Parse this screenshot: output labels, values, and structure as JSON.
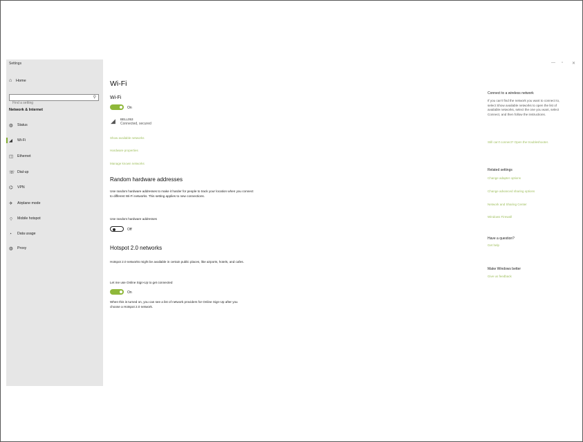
{
  "app": {
    "title": "Settings"
  },
  "window_controls": {
    "minimize": "—",
    "maximize": "▫",
    "close": "✕"
  },
  "sidebar": {
    "home_label": "Home",
    "search_placeholder": "Find a setting",
    "search_icon": "search-icon",
    "section_heading": "Network & Internet",
    "items": [
      {
        "label": "Status",
        "icon": "globe-icon"
      },
      {
        "label": "Wi-Fi",
        "icon": "wifi-icon",
        "active": true
      },
      {
        "label": "Ethernet",
        "icon": "ethernet-icon"
      },
      {
        "label": "Dial-up",
        "icon": "dialup-icon"
      },
      {
        "label": "VPN",
        "icon": "vpn-icon"
      },
      {
        "label": "Airplane mode",
        "icon": "airplane-icon"
      },
      {
        "label": "Mobile hotspot",
        "icon": "hotspot-icon"
      },
      {
        "label": "Data usage",
        "icon": "data-usage-icon"
      },
      {
        "label": "Proxy",
        "icon": "globe-icon"
      }
    ]
  },
  "main": {
    "title": "Wi-Fi",
    "wifi": {
      "heading": "Wi-Fi",
      "state": "On"
    },
    "network": {
      "name": "BELL053",
      "status": "Connected, secured"
    },
    "links": [
      "Show available networks",
      "Hardware properties",
      "Manage known networks"
    ],
    "random_hw": {
      "heading": "Random hardware addresses",
      "description": "Use random hardware addresses to make it harder for people to track your location when you connect to different Wi-Fi networks. This setting applies to new connections.",
      "toggle_label": "Use random hardware addresses",
      "state": "Off"
    },
    "hotspot": {
      "heading": "Hotspot 2.0 networks",
      "description": "Hotspot 2.0 networks might be available in certain public places, like airports, hotels, and cafes.",
      "toggle_label": "Let me use Online Sign-Up to get connected",
      "state": "On",
      "note": "When this is turned on, you can see a list of network providers for Online Sign-Up after you choose a Hotspot 2.0 network."
    }
  },
  "right": {
    "connect": {
      "heading": "Connect to a wireless network",
      "text": "If you can't find the network you want to connect to, select Show available networks to open the list of available networks, select the one you want, select Connect, and then follow the instructions.",
      "link": "Still can't connect? Open the troubleshooter."
    },
    "related": {
      "heading": "Related settings",
      "links": [
        "Change adapter options",
        "Change advanced sharing options",
        "Network and Sharing Center",
        "Windows Firewall"
      ]
    },
    "question": {
      "heading": "Have a question?",
      "link": "Get help"
    },
    "feedback": {
      "heading": "Make Windows better",
      "link": "Give us feedback"
    }
  },
  "colors": {
    "accent": "#8fb83a",
    "link": "#9fbf5e",
    "sidebar_bg": "#e6e6e6"
  }
}
